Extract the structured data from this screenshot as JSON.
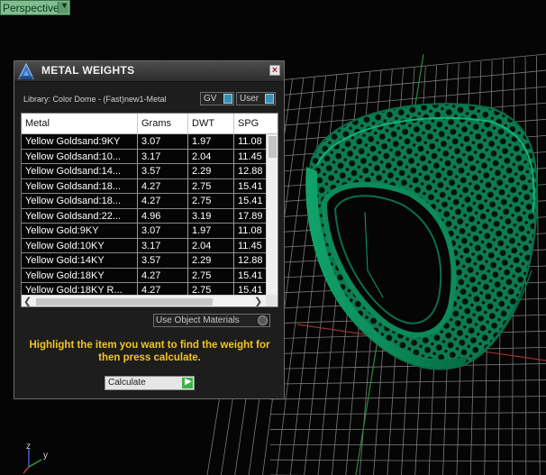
{
  "viewport": {
    "view_name": "Perspective",
    "axis_labels": {
      "z": "z",
      "y": "y"
    },
    "colors": {
      "grid": "#8a8a8a",
      "model": "#0e8a5c",
      "x_axis": "#b33b3b",
      "y_axis": "#2f8f3f"
    }
  },
  "panel": {
    "title": "METAL WEIGHTS",
    "library_label": "Library: Color Dome - (Fast)new1-Metal",
    "gv_label": "GV",
    "user_label": "User",
    "table": {
      "columns": [
        "Metal",
        "Grams",
        "DWT",
        "SPG"
      ],
      "rows": [
        [
          "Yellow Goldsand:9KY",
          "3.07",
          "1.97",
          "11.08"
        ],
        [
          "Yellow Goldsand:10...",
          "3.17",
          "2.04",
          "11.45"
        ],
        [
          "Yellow Goldsand:14...",
          "3.57",
          "2.29",
          "12.88"
        ],
        [
          "Yellow Goldsand:18...",
          "4.27",
          "2.75",
          "15.41"
        ],
        [
          "Yellow Goldsand:18...",
          "4.27",
          "2.75",
          "15.41"
        ],
        [
          "Yellow Goldsand:22...",
          "4.96",
          "3.19",
          "17.89"
        ],
        [
          "Yellow Gold:9KY",
          "3.07",
          "1.97",
          "11.08"
        ],
        [
          "Yellow Gold:10KY",
          "3.17",
          "2.04",
          "11.45"
        ],
        [
          "Yellow Gold:14KY",
          "3.57",
          "2.29",
          "12.88"
        ],
        [
          "Yellow Gold:18KY",
          "4.27",
          "2.75",
          "15.41"
        ],
        [
          "Yellow Gold:18KY R...",
          "4.27",
          "2.75",
          "15.41"
        ]
      ]
    },
    "use_object_materials_label": "Use Object Materials",
    "instruction": "Highlight the item you want to find the weight for then press calculate.",
    "calculate_label": "Calculate",
    "colors": {
      "instruction": "#f2c520",
      "accent": "#3bb44a"
    }
  }
}
